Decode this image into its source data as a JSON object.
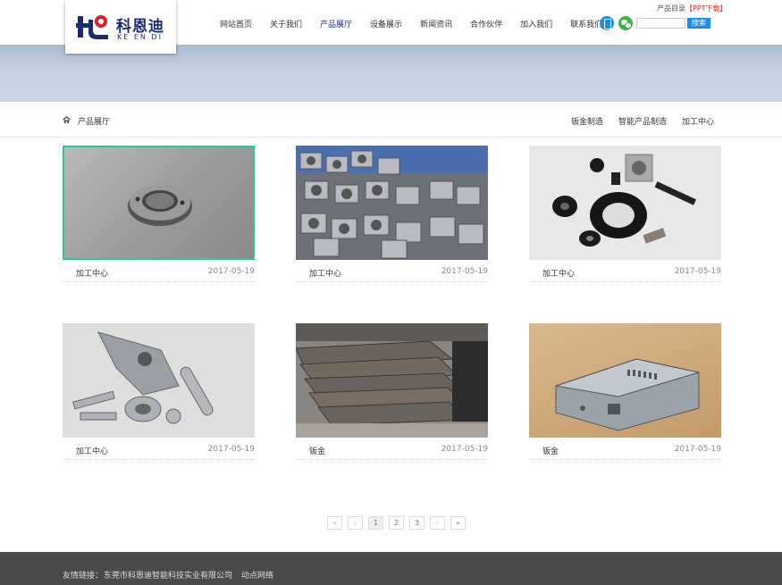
{
  "logo": {
    "cn": "科恩迪",
    "en": "KE EN DI"
  },
  "top_links": {
    "catalog": "产品目录",
    "ppt": "【PPT下载】"
  },
  "nav": [
    {
      "label": "网站首页",
      "active": false
    },
    {
      "label": "关于我们",
      "active": false
    },
    {
      "label": "产品展厅",
      "active": true
    },
    {
      "label": "设备展示",
      "active": false
    },
    {
      "label": "新闻资讯",
      "active": false
    },
    {
      "label": "合作伙伴",
      "active": false
    },
    {
      "label": "加入我们",
      "active": false
    },
    {
      "label": "联系我们",
      "active": false
    }
  ],
  "search": {
    "value": "",
    "button": "搜索"
  },
  "breadcrumb": {
    "title": "产品展厅"
  },
  "subnav": [
    "钣金制造",
    "智能产品制造",
    "加工中心"
  ],
  "products": [
    {
      "name": "加工中心",
      "date": "2017-05-19"
    },
    {
      "name": "加工中心",
      "date": "2017-05-19"
    },
    {
      "name": "加工中心",
      "date": "2017-05-19"
    },
    {
      "name": "加工中心",
      "date": "2017-05-19"
    },
    {
      "name": "钣金",
      "date": "2017-05-19"
    },
    {
      "name": "钣金",
      "date": "2017-05-19"
    }
  ],
  "pagination": {
    "first": "«",
    "prev": "‹",
    "pages": [
      "1",
      "2",
      "3"
    ],
    "next": "›",
    "last": "»"
  },
  "footer": {
    "label": "友情链接：",
    "links": [
      "东莞市科恩迪智能科技实业有限公司",
      "动点网络"
    ]
  },
  "colors": {
    "brand_navy": "#1c2a6e",
    "accent_blue": "#1d8ee6",
    "selected_border": "#2bc7a0",
    "footer_bg": "#4a4a4a"
  }
}
